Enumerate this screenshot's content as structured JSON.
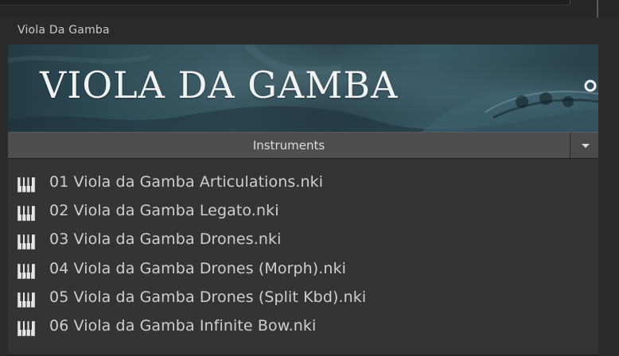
{
  "library": {
    "title": "Viola Da Gamba",
    "banner_text": "VIOLA DA GAMBA"
  },
  "header": {
    "label": "Instruments",
    "dropdown_icon": "chevron-down-icon"
  },
  "instruments": [
    {
      "name": "01 Viola da Gamba Articulations.nki",
      "icon": "keyboard-icon"
    },
    {
      "name": "02 Viola da Gamba Legato.nki",
      "icon": "keyboard-icon"
    },
    {
      "name": "03 Viola da Gamba Drones.nki",
      "icon": "keyboard-icon"
    },
    {
      "name": "04 Viola da Gamba Drones (Morph).nki",
      "icon": "keyboard-icon"
    },
    {
      "name": "05 Viola da Gamba Drones (Split Kbd).nki",
      "icon": "keyboard-icon"
    },
    {
      "name": "06 Viola da Gamba Infinite Bow.nki",
      "icon": "keyboard-icon"
    }
  ],
  "colors": {
    "background": "#2a2a2a",
    "list_background": "#343434",
    "header_bar": "#4e4e4e",
    "text": "#cfcfcf",
    "banner_teal": "#2f4d58"
  }
}
